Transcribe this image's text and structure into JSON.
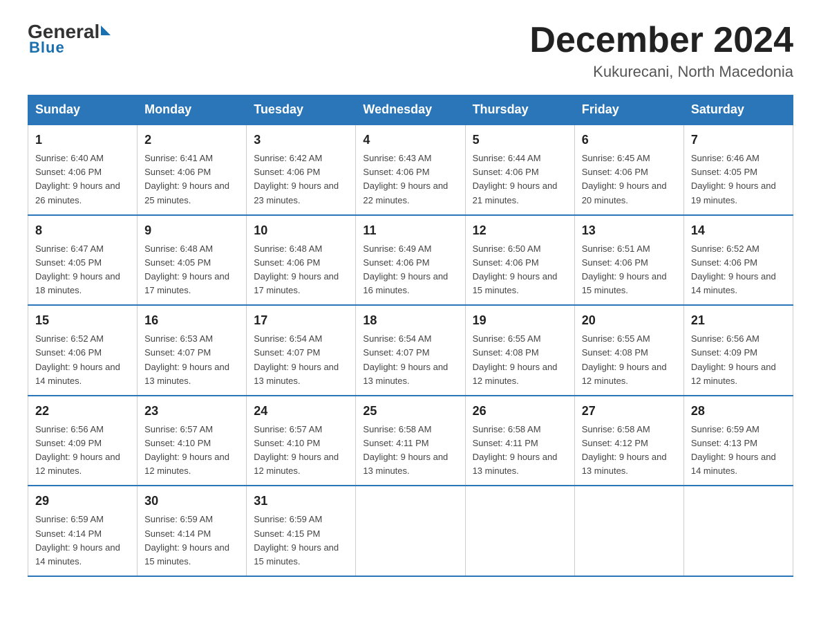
{
  "logo": {
    "general": "General",
    "blue": "Blue"
  },
  "header": {
    "month": "December 2024",
    "location": "Kukurecani, North Macedonia"
  },
  "weekdays": [
    "Sunday",
    "Monday",
    "Tuesday",
    "Wednesday",
    "Thursday",
    "Friday",
    "Saturday"
  ],
  "weeks": [
    [
      {
        "day": "1",
        "sunrise": "6:40 AM",
        "sunset": "4:06 PM",
        "daylight": "9 hours and 26 minutes."
      },
      {
        "day": "2",
        "sunrise": "6:41 AM",
        "sunset": "4:06 PM",
        "daylight": "9 hours and 25 minutes."
      },
      {
        "day": "3",
        "sunrise": "6:42 AM",
        "sunset": "4:06 PM",
        "daylight": "9 hours and 23 minutes."
      },
      {
        "day": "4",
        "sunrise": "6:43 AM",
        "sunset": "4:06 PM",
        "daylight": "9 hours and 22 minutes."
      },
      {
        "day": "5",
        "sunrise": "6:44 AM",
        "sunset": "4:06 PM",
        "daylight": "9 hours and 21 minutes."
      },
      {
        "day": "6",
        "sunrise": "6:45 AM",
        "sunset": "4:06 PM",
        "daylight": "9 hours and 20 minutes."
      },
      {
        "day": "7",
        "sunrise": "6:46 AM",
        "sunset": "4:05 PM",
        "daylight": "9 hours and 19 minutes."
      }
    ],
    [
      {
        "day": "8",
        "sunrise": "6:47 AM",
        "sunset": "4:05 PM",
        "daylight": "9 hours and 18 minutes."
      },
      {
        "day": "9",
        "sunrise": "6:48 AM",
        "sunset": "4:05 PM",
        "daylight": "9 hours and 17 minutes."
      },
      {
        "day": "10",
        "sunrise": "6:48 AM",
        "sunset": "4:06 PM",
        "daylight": "9 hours and 17 minutes."
      },
      {
        "day": "11",
        "sunrise": "6:49 AM",
        "sunset": "4:06 PM",
        "daylight": "9 hours and 16 minutes."
      },
      {
        "day": "12",
        "sunrise": "6:50 AM",
        "sunset": "4:06 PM",
        "daylight": "9 hours and 15 minutes."
      },
      {
        "day": "13",
        "sunrise": "6:51 AM",
        "sunset": "4:06 PM",
        "daylight": "9 hours and 15 minutes."
      },
      {
        "day": "14",
        "sunrise": "6:52 AM",
        "sunset": "4:06 PM",
        "daylight": "9 hours and 14 minutes."
      }
    ],
    [
      {
        "day": "15",
        "sunrise": "6:52 AM",
        "sunset": "4:06 PM",
        "daylight": "9 hours and 14 minutes."
      },
      {
        "day": "16",
        "sunrise": "6:53 AM",
        "sunset": "4:07 PM",
        "daylight": "9 hours and 13 minutes."
      },
      {
        "day": "17",
        "sunrise": "6:54 AM",
        "sunset": "4:07 PM",
        "daylight": "9 hours and 13 minutes."
      },
      {
        "day": "18",
        "sunrise": "6:54 AM",
        "sunset": "4:07 PM",
        "daylight": "9 hours and 13 minutes."
      },
      {
        "day": "19",
        "sunrise": "6:55 AM",
        "sunset": "4:08 PM",
        "daylight": "9 hours and 12 minutes."
      },
      {
        "day": "20",
        "sunrise": "6:55 AM",
        "sunset": "4:08 PM",
        "daylight": "9 hours and 12 minutes."
      },
      {
        "day": "21",
        "sunrise": "6:56 AM",
        "sunset": "4:09 PM",
        "daylight": "9 hours and 12 minutes."
      }
    ],
    [
      {
        "day": "22",
        "sunrise": "6:56 AM",
        "sunset": "4:09 PM",
        "daylight": "9 hours and 12 minutes."
      },
      {
        "day": "23",
        "sunrise": "6:57 AM",
        "sunset": "4:10 PM",
        "daylight": "9 hours and 12 minutes."
      },
      {
        "day": "24",
        "sunrise": "6:57 AM",
        "sunset": "4:10 PM",
        "daylight": "9 hours and 12 minutes."
      },
      {
        "day": "25",
        "sunrise": "6:58 AM",
        "sunset": "4:11 PM",
        "daylight": "9 hours and 13 minutes."
      },
      {
        "day": "26",
        "sunrise": "6:58 AM",
        "sunset": "4:11 PM",
        "daylight": "9 hours and 13 minutes."
      },
      {
        "day": "27",
        "sunrise": "6:58 AM",
        "sunset": "4:12 PM",
        "daylight": "9 hours and 13 minutes."
      },
      {
        "day": "28",
        "sunrise": "6:59 AM",
        "sunset": "4:13 PM",
        "daylight": "9 hours and 14 minutes."
      }
    ],
    [
      {
        "day": "29",
        "sunrise": "6:59 AM",
        "sunset": "4:14 PM",
        "daylight": "9 hours and 14 minutes."
      },
      {
        "day": "30",
        "sunrise": "6:59 AM",
        "sunset": "4:14 PM",
        "daylight": "9 hours and 15 minutes."
      },
      {
        "day": "31",
        "sunrise": "6:59 AM",
        "sunset": "4:15 PM",
        "daylight": "9 hours and 15 minutes."
      },
      {
        "day": "",
        "sunrise": "",
        "sunset": "",
        "daylight": ""
      },
      {
        "day": "",
        "sunrise": "",
        "sunset": "",
        "daylight": ""
      },
      {
        "day": "",
        "sunrise": "",
        "sunset": "",
        "daylight": ""
      },
      {
        "day": "",
        "sunrise": "",
        "sunset": "",
        "daylight": ""
      }
    ]
  ]
}
